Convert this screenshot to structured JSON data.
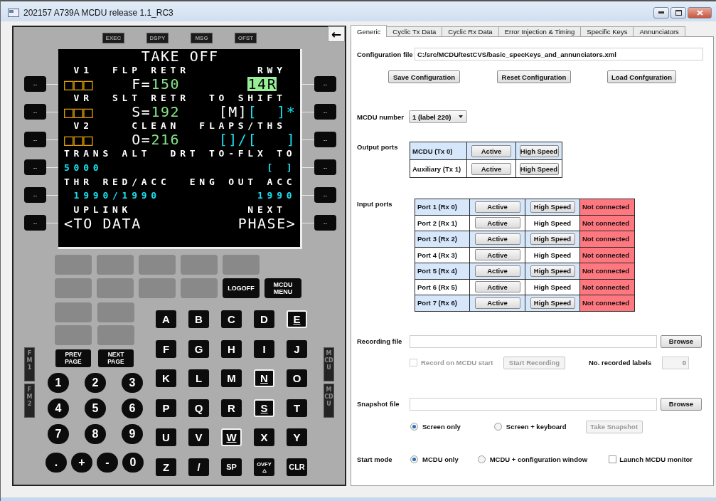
{
  "window": {
    "title": "202157 A739A MCDU release 1.1_RC3"
  },
  "mcdu": {
    "annunciators": [
      {
        "label": "EXEC",
        "lit": false
      },
      {
        "label": "DSPY",
        "lit": false
      },
      {
        "label": "MSG",
        "lit": false
      },
      {
        "label": "OFST",
        "lit": false
      }
    ],
    "back_button": {
      "label": "←"
    },
    "screen": {
      "lines": [
        {
          "kind": "large",
          "segments": [
            {
              "kind": "text",
              "text": "        TAKE OFF",
              "color": "#ffffff",
              "highlighted": false
            }
          ]
        },
        {
          "kind": "small",
          "segments": [
            {
              "kind": "text",
              "text": " V1  FLP RETR       RWY",
              "color": "#ffffff",
              "highlighted": false
            }
          ]
        },
        {
          "kind": "large",
          "segments": [
            {
              "kind": "boxes",
              "text": "□□□",
              "color": "#e0a000",
              "highlighted": false
            },
            {
              "kind": "text",
              "text": "    F=",
              "color": "#ffffff",
              "highlighted": false
            },
            {
              "kind": "text",
              "text": "150       ",
              "color": "#86e686",
              "highlighted": false
            },
            {
              "kind": "text",
              "text": "14R",
              "color": "#98ee98",
              "highlighted": true
            }
          ]
        },
        {
          "kind": "small",
          "segments": [
            {
              "kind": "text",
              "text": " VR  SLT RETR  TO SHIFT",
              "color": "#ffffff",
              "highlighted": false
            }
          ]
        },
        {
          "kind": "large",
          "segments": [
            {
              "kind": "boxes",
              "text": "□□□",
              "color": "#e0a000",
              "highlighted": false
            },
            {
              "kind": "text",
              "text": "    S=",
              "color": "#ffffff",
              "highlighted": false
            },
            {
              "kind": "text",
              "text": "192    ",
              "color": "#86e686",
              "highlighted": false
            },
            {
              "kind": "text",
              "text": "[M]",
              "color": "#ffffff",
              "highlighted": false
            },
            {
              "kind": "text",
              "text": "[  ]*",
              "color": "#19e0f0",
              "highlighted": false
            }
          ]
        },
        {
          "kind": "small",
          "segments": [
            {
              "kind": "text",
              "text": " V2    CLEAN  FLAPS/THS",
              "color": "#ffffff",
              "highlighted": false
            }
          ]
        },
        {
          "kind": "large",
          "segments": [
            {
              "kind": "boxes",
              "text": "□□□",
              "color": "#e0a000",
              "highlighted": false
            },
            {
              "kind": "text",
              "text": "    O=",
              "color": "#ffffff",
              "highlighted": false
            },
            {
              "kind": "text",
              "text": "216    ",
              "color": "#86e686",
              "highlighted": false
            },
            {
              "kind": "text",
              "text": "[]/[   ]",
              "color": "#19e0f0",
              "highlighted": false
            }
          ]
        },
        {
          "kind": "small",
          "segments": [
            {
              "kind": "text",
              "text": "TRANS ALT  DRT TO-FLX TO",
              "color": "#ffffff",
              "highlighted": false
            }
          ]
        },
        {
          "kind": "small",
          "segments": [
            {
              "kind": "text",
              "text": "5000                 [ ]",
              "color": "#19e0f0",
              "highlighted": false
            }
          ]
        },
        {
          "kind": "small",
          "segments": [
            {
              "kind": "text",
              "text": "THR RED/ACC  ENG OUT ACC",
              "color": "#ffffff",
              "highlighted": false
            }
          ]
        },
        {
          "kind": "small",
          "segments": [
            {
              "kind": "text",
              "text": " 1990/1990          1990",
              "color": "#19e0f0",
              "highlighted": false
            }
          ]
        },
        {
          "kind": "small",
          "segments": [
            {
              "kind": "text",
              "text": " UPLINK            NEXT",
              "color": "#ffffff",
              "highlighted": false
            }
          ]
        },
        {
          "kind": "large",
          "segments": [
            {
              "kind": "text",
              "text": "<TO DATA          PHASE>",
              "color": "#ffffff",
              "highlighted": false
            }
          ]
        }
      ]
    },
    "left_keys": [
      {
        "label": "--"
      },
      {
        "label": "--"
      },
      {
        "label": "--"
      },
      {
        "label": "--"
      },
      {
        "label": "--"
      },
      {
        "label": "--"
      }
    ],
    "right_keys": [
      {
        "label": "--"
      },
      {
        "label": "--"
      },
      {
        "label": "--"
      },
      {
        "label": "--"
      },
      {
        "label": "--"
      },
      {
        "label": "--"
      }
    ],
    "function_key_rows": [
      {
        "keys": [
          {
            "kind": "blank"
          },
          {
            "kind": "blank"
          },
          {
            "kind": "blank"
          },
          {
            "kind": "blank"
          },
          {
            "kind": "blank"
          }
        ]
      },
      {
        "keys": [
          {
            "kind": "blank"
          },
          {
            "kind": "blank"
          },
          {
            "kind": "blank"
          },
          {
            "kind": "blank"
          },
          {
            "kind": "labeled",
            "label": "LOGOFF"
          },
          {
            "kind": "labeled",
            "label": "MCDU MENU"
          }
        ]
      }
    ],
    "side_keys": [
      {
        "kind": "blank"
      },
      {
        "kind": "blank"
      },
      {
        "kind": "blank"
      },
      {
        "kind": "blank"
      }
    ],
    "page_keys": [
      {
        "label": "PREV PAGE"
      },
      {
        "label": "NEXT PAGE"
      }
    ],
    "number_keys": [
      {
        "label": "1"
      },
      {
        "label": "2"
      },
      {
        "label": "3"
      },
      {
        "label": "4"
      },
      {
        "label": "5"
      },
      {
        "label": "6"
      },
      {
        "label": "7"
      },
      {
        "label": "8"
      },
      {
        "label": "9"
      }
    ],
    "sign_keys": [
      {
        "label": "."
      },
      {
        "label": "+"
      },
      {
        "label": "-"
      },
      {
        "label": "0"
      }
    ],
    "letter_keys": [
      {
        "label": "A",
        "highlighted": false
      },
      {
        "label": "B",
        "highlighted": false
      },
      {
        "label": "C",
        "highlighted": false
      },
      {
        "label": "D",
        "highlighted": false
      },
      {
        "label": "E",
        "highlighted": true
      },
      {
        "label": "F",
        "highlighted": false
      },
      {
        "label": "G",
        "highlighted": false
      },
      {
        "label": "H",
        "highlighted": false
      },
      {
        "label": "I",
        "highlighted": false
      },
      {
        "label": "J",
        "highlighted": false
      },
      {
        "label": "K",
        "highlighted": false
      },
      {
        "label": "L",
        "highlighted": false
      },
      {
        "label": "M",
        "highlighted": false
      },
      {
        "label": "N",
        "highlighted": true
      },
      {
        "label": "O",
        "highlighted": false
      },
      {
        "label": "P",
        "highlighted": false
      },
      {
        "label": "Q",
        "highlighted": false
      },
      {
        "label": "R",
        "highlighted": false
      },
      {
        "label": "S",
        "highlighted": true
      },
      {
        "label": "T",
        "highlighted": false
      },
      {
        "label": "U",
        "highlighted": false
      },
      {
        "label": "V",
        "highlighted": false
      },
      {
        "label": "W",
        "highlighted": true
      },
      {
        "label": "X",
        "highlighted": false
      },
      {
        "label": "Y",
        "highlighted": false
      },
      {
        "label": "Z",
        "highlighted": false
      },
      {
        "label": "/",
        "highlighted": false
      },
      {
        "label": "SP",
        "highlighted": false
      },
      {
        "label": "OVFY",
        "highlighted": false,
        "kind": "overfly"
      },
      {
        "label": "CLR",
        "highlighted": false
      }
    ],
    "left_indicators": [
      {
        "label": "FM1",
        "lit": false
      },
      {
        "label": "FM2",
        "lit": false
      }
    ],
    "right_indicators": [
      {
        "label": "MCDU",
        "lit": false
      },
      {
        "label": "MCDU",
        "lit": false
      }
    ]
  },
  "config": {
    "tabs": [
      {
        "label": "Generic",
        "selected": true
      },
      {
        "label": "Cyclic Tx Data",
        "selected": false
      },
      {
        "label": "Cyclic Rx Data",
        "selected": false
      },
      {
        "label": "Error Injection & Timing",
        "selected": false
      },
      {
        "label": "Specific Keys",
        "selected": false
      },
      {
        "label": "Annunciators",
        "selected": false
      }
    ],
    "configuration_file": {
      "label": "Configuration file",
      "value": "C:/src/MCDU/testCVS/basic_specKeys_and_annunciators.xml"
    },
    "config_buttons": [
      "Save Configuration",
      "Reset Configuration",
      "Load Confguration"
    ],
    "mcdu_number": {
      "label": "MCDU number",
      "value": "1 (label 220)"
    },
    "output_ports": {
      "label": "Output ports",
      "rows": [
        {
          "name": "MCDU (Tx 0)",
          "highlighted": true,
          "active": "Active",
          "high_speed": "High Speed",
          "kind": "raised"
        },
        {
          "name": "Auxiliary (Tx 1)",
          "highlighted": false,
          "active": "Active",
          "high_speed": "High Speed",
          "kind": "raised"
        }
      ]
    },
    "input_ports": {
      "label": "Input ports",
      "rows": [
        {
          "name": "Port 1 (Rx 0)",
          "highlighted": true,
          "active": "Active",
          "high_speed": "High Speed",
          "kind": "raised",
          "status": "Not connected",
          "color": "#ff7880"
        },
        {
          "name": "Port 2 (Rx 1)",
          "highlighted": false,
          "active": "Active",
          "high_speed": "High Speed",
          "kind": "flat",
          "status": "Not connected",
          "color": "#ff7880"
        },
        {
          "name": "Port 3 (Rx 2)",
          "highlighted": true,
          "active": "Active",
          "high_speed": "High Speed",
          "kind": "raised",
          "status": "Not connected",
          "color": "#ff7880"
        },
        {
          "name": "Port 4 (Rx 3)",
          "highlighted": false,
          "active": "Active",
          "high_speed": "High Speed",
          "kind": "flat",
          "status": "Not connected",
          "color": "#ff7880"
        },
        {
          "name": "Port 5 (Rx 4)",
          "highlighted": true,
          "active": "Active",
          "high_speed": "High Speed",
          "kind": "raised",
          "status": "Not connected",
          "color": "#ff7880"
        },
        {
          "name": "Port 6 (Rx 5)",
          "highlighted": false,
          "active": "Active",
          "high_speed": "High Speed",
          "kind": "flat",
          "status": "Not connected",
          "color": "#ff7880"
        },
        {
          "name": "Port 7 (Rx 6)",
          "highlighted": true,
          "active": "Active",
          "high_speed": "High Speed",
          "kind": "raised",
          "status": "Not connected",
          "color": "#ff7880"
        }
      ]
    },
    "recording": {
      "label": "Recording file",
      "browse": "Browse",
      "record_on_start": {
        "label": "Record on MCDU start",
        "checked": false,
        "disabled": true
      },
      "start_button": {
        "label": "Start Recording",
        "disabled": true
      },
      "count_label": "No. recorded labels",
      "count": "0"
    },
    "snapshot": {
      "label": "Snapshot file",
      "browse": "Browse",
      "options": [
        {
          "label": "Screen only",
          "selected": true
        },
        {
          "label": "Screen + keyboard",
          "selected": false
        }
      ],
      "take_button": {
        "label": "Take Snapshot",
        "disabled": true
      }
    },
    "start_mode": {
      "label": "Start mode",
      "options": [
        {
          "label": "MCDU only",
          "selected": true
        },
        {
          "label": "MCDU + configuration window",
          "selected": false
        }
      ],
      "monitor": {
        "label": "Launch MCDU monitor",
        "checked": false
      }
    }
  }
}
